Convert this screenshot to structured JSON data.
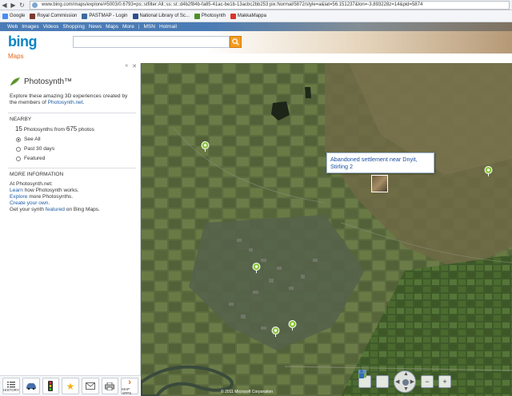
{
  "browser": {
    "url": "www.bing.com/maps/explore/#5003/0.6793=ps::stfilter:All::ss::st::d4b2f84b-fa85-41ac-be1b-13acbc2bb253:pix:Normal/5872/style=a&lat=56.151237&lon=-3.893228z=14&pid=5874",
    "bookmarks": [
      "Google",
      "Royal Commission",
      "PASTMAP - Login",
      "National Library of Sc...",
      "Photosynth",
      "MakkaMappa"
    ]
  },
  "bing": {
    "nav": [
      "Web",
      "Images",
      "Videos",
      "Shopping",
      "News",
      "Maps",
      "More",
      "|",
      "MSN",
      "Hotmail"
    ],
    "logo": "bing",
    "section": "Maps",
    "search_placeholder": ""
  },
  "panel": {
    "title": "Photosynth™",
    "description_pre": "Explore these amazing 3D experiences created by the members of ",
    "description_link": "Photosynth.net",
    "description_post": ".",
    "nearby_title": "NEARBY",
    "nearby_count": "15",
    "nearby_mid": " Photosynths from ",
    "nearby_photos": "675",
    "nearby_tail": " photos",
    "filters": [
      {
        "label": "See All",
        "selected": true
      },
      {
        "label": "Past 30 days",
        "selected": false
      },
      {
        "label": "Featured",
        "selected": false
      }
    ],
    "more_title": "MORE INFORMATION",
    "more_intro": "At Photosynth.net:",
    "more_learn_link": "Learn",
    "more_learn_rest": " how Photosynth works.",
    "more_explore_link": "Explore",
    "more_explore_rest": " more Photosynths.",
    "more_create_link": "Create your own.",
    "more_featured_pre": "Get your synth ",
    "more_featured_link": "featured",
    "more_featured_post": " on Bing Maps."
  },
  "toolbar": {
    "history": "HISTORY",
    "map_apps": "MAP APPS"
  },
  "map": {
    "popup_title": "Abandoned settlement near Dnyit, Stirling 2",
    "copyright": "© 2011 Microsoft Corporation"
  },
  "colors": {
    "bing_blue": "#0b86c6",
    "maps_orange": "#e5661a",
    "link_blue": "#1a5aa6",
    "pin_green": "#8cc63f"
  }
}
